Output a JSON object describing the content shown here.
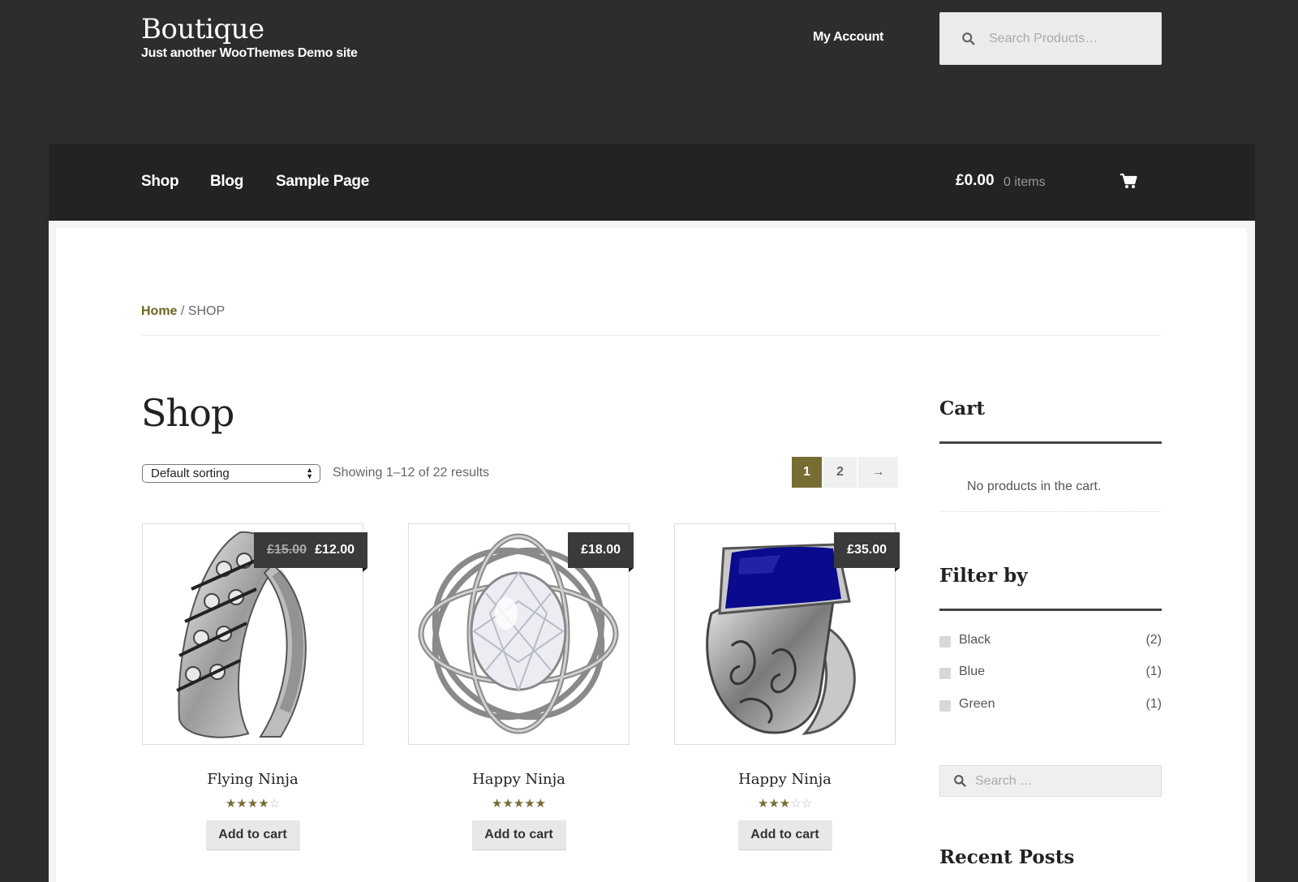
{
  "header": {
    "site_title": "Boutique",
    "site_description": "Just another WooThemes Demo site",
    "my_account": "My Account",
    "search_placeholder": "Search Products…"
  },
  "nav": {
    "items": [
      {
        "label": "Shop"
      },
      {
        "label": "Blog"
      },
      {
        "label": "Sample Page"
      }
    ],
    "cart_total": "£0.00",
    "cart_count": "0 items"
  },
  "breadcrumb": {
    "home": "Home",
    "separator": " / ",
    "current": "SHOP"
  },
  "main": {
    "title": "Shop",
    "sorting": "Default sorting",
    "result_count": "Showing 1–12 of 22 results",
    "pagination": [
      "1",
      "2",
      "→"
    ],
    "products": [
      {
        "name": "Flying Ninja",
        "old_price": "£15.00",
        "price": "£12.00",
        "rating": 4,
        "add_label": "Add to cart"
      },
      {
        "name": "Happy Ninja",
        "old_price": "",
        "price": "£18.00",
        "rating": 5,
        "add_label": "Add to cart"
      },
      {
        "name": "Happy Ninja",
        "old_price": "",
        "price": "£35.00",
        "rating": 3,
        "add_label": "Add to cart"
      }
    ]
  },
  "sidebar": {
    "cart_title": "Cart",
    "cart_empty": "No products in the cart.",
    "filter_title": "Filter by",
    "filters": [
      {
        "label": "Black",
        "count": "(2)"
      },
      {
        "label": "Blue",
        "count": "(1)"
      },
      {
        "label": "Green",
        "count": "(1)"
      }
    ],
    "search_placeholder": "Search …",
    "recent_posts_title": "Recent Posts"
  },
  "colors": {
    "accent": "#766d35",
    "header_bg": "#2d2d2d",
    "nav_bg": "#232323",
    "price_tag_bg": "#3a3a3a"
  }
}
